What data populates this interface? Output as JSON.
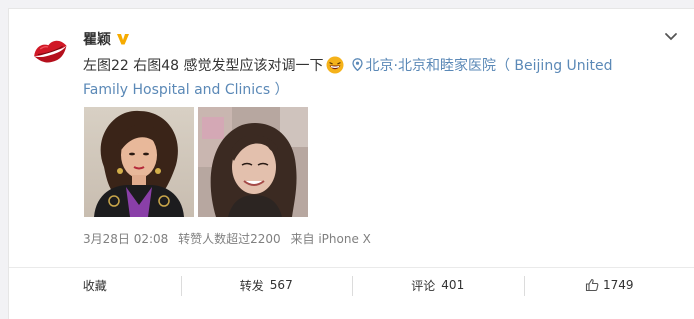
{
  "post": {
    "author": "瞿颖",
    "text": "左图22 右图48 感觉发型应该对调一下",
    "location": "北京·北京和睦家医院（ Beijing United Family Hospital and Clinics ）",
    "date": "3月28日 02:08",
    "repost_info": "转赞人数超过2200",
    "source": "来自 iPhone X"
  },
  "actions": {
    "favorite": "收藏",
    "repost_label": "转发",
    "repost_count": "567",
    "comment_label": "评论",
    "comment_count": "401",
    "like_count": "1749"
  },
  "icons": {
    "verified": "v-badge-icon",
    "more": "chevron-down-icon",
    "location": "location-pin-icon",
    "emoji": "laughing-emoji-icon",
    "like": "thumbs-up-icon"
  },
  "colors": {
    "link": "#5b89b7",
    "verified_gold": "#f6ab00",
    "meta_gray": "#808080"
  }
}
